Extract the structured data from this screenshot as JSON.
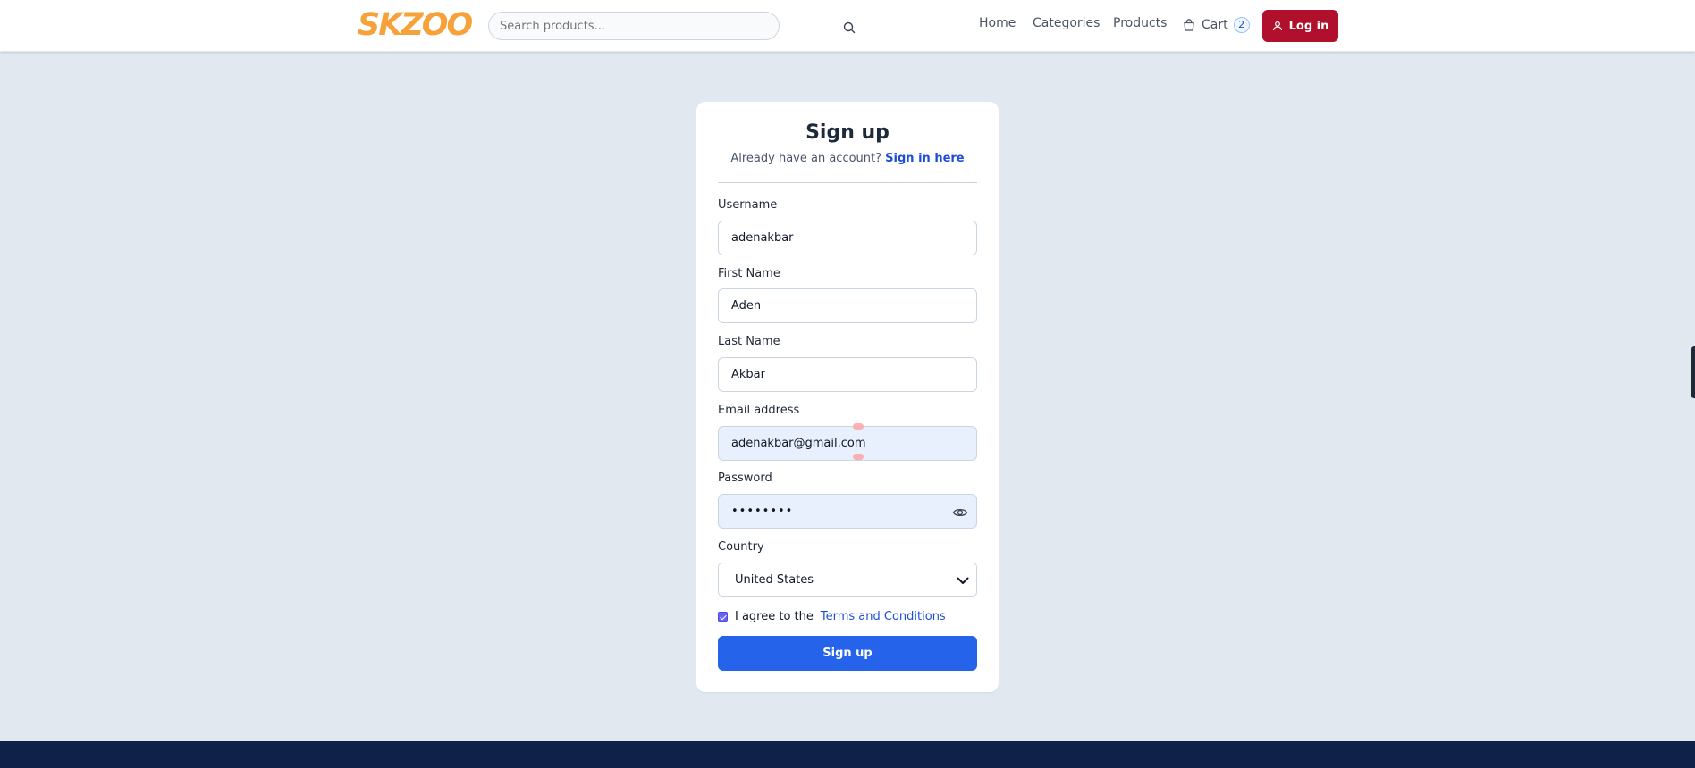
{
  "header": {
    "logo_text": "SKZOO",
    "search_placeholder": "Search products...",
    "nav": {
      "home": "Home",
      "categories": "Categories",
      "products": "Products",
      "cart_label": "Cart",
      "cart_count": "2"
    },
    "login_label": "Log in"
  },
  "signup": {
    "title": "Sign up",
    "subtitle_prefix": "Already have an account?",
    "subtitle_link": "Sign in here",
    "fields": {
      "username": {
        "label": "Username",
        "value": "adenakbar"
      },
      "first_name": {
        "label": "First Name",
        "value": "Aden"
      },
      "last_name": {
        "label": "Last Name",
        "value": "Akbar"
      },
      "email": {
        "label": "Email address",
        "value": "adenakbar@gmail.com"
      },
      "password": {
        "label": "Password",
        "value": "••••••••"
      },
      "country": {
        "label": "Country",
        "value": "United States"
      }
    },
    "agree_prefix": "I agree to the",
    "terms_link": "Terms and Conditions",
    "agree_checked": true,
    "submit_label": "Sign up"
  },
  "colors": {
    "background": "#e2e8f0",
    "logo": "#f7a13a",
    "login_button": "#b0102b",
    "primary": "#2563eb",
    "link": "#1d4ed8",
    "footer": "#0f2148",
    "autofill": "#e8f0fe"
  },
  "icons": [
    "search-icon",
    "shopping-bag-icon",
    "user-icon",
    "eye-icon",
    "chevron-down-icon",
    "check-icon"
  ]
}
